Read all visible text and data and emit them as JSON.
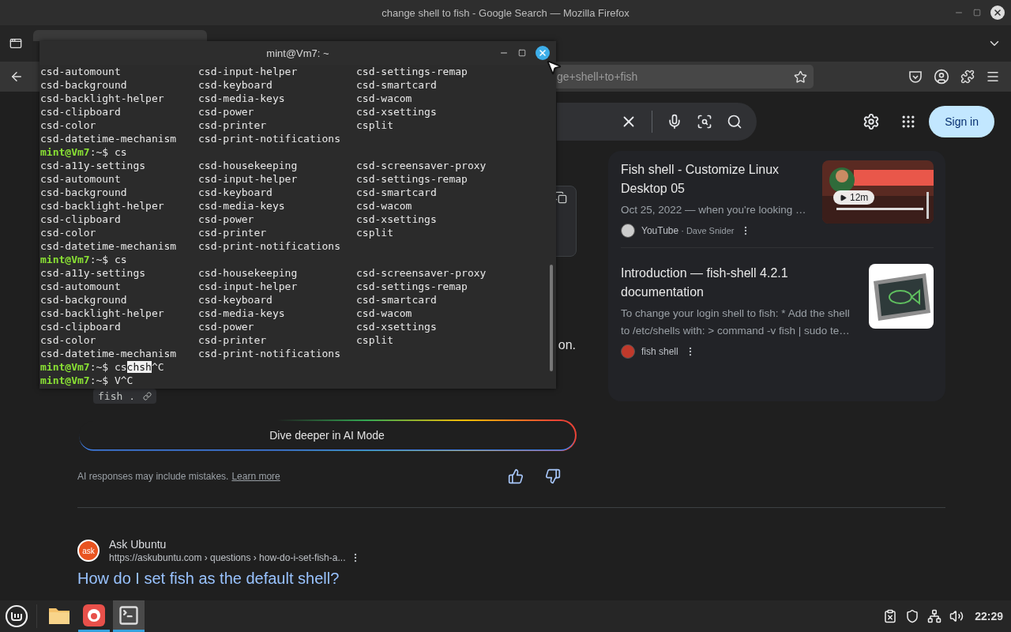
{
  "firefox": {
    "title": "change shell to fish - Google Search — Mozilla Firefox",
    "url_visible": "ge+shell+to+fish"
  },
  "google": {
    "sign_in": "Sign in"
  },
  "ai_overview": {
    "hidden_fragment": "on.",
    "code_chip": "fish .",
    "ai_mode_button": "Dive deeper in AI Mode",
    "disclaimer": "AI responses may include mistakes.",
    "learn_more": "Learn more"
  },
  "side_results": [
    {
      "kind": "video",
      "title": "Fish shell - Customize Linux Desktop 05",
      "snippet": "Oct 25, 2022 — when you're looking …",
      "source": "YouTube",
      "author": "· Dave Snider",
      "duration": "12m"
    },
    {
      "kind": "doc",
      "title": "Introduction — fish-shell 4.2.1 documentation",
      "snippet": "To change your login shell to fish: * Add the shell to /etc/shells with: > command -v fish | sudo te…",
      "source": "fish shell"
    }
  ],
  "result": {
    "site": "Ask Ubuntu",
    "logo_text": "ask",
    "url": "https://askubuntu.com › questions › how-do-i-set-fish-a...",
    "title": "How do I set fish as the default shell?"
  },
  "terminal": {
    "title": "mint@Vm7: ~",
    "lines": [
      {
        "kind": "columns",
        "cells": [
          "csd-automount",
          "csd-input-helper",
          "csd-settings-remap"
        ]
      },
      {
        "kind": "columns",
        "cells": [
          "csd-background",
          "csd-keyboard",
          "csd-smartcard"
        ]
      },
      {
        "kind": "columns",
        "cells": [
          "csd-backlight-helper",
          "csd-media-keys",
          "csd-wacom"
        ]
      },
      {
        "kind": "columns",
        "cells": [
          "csd-clipboard",
          "csd-power",
          "csd-xsettings"
        ]
      },
      {
        "kind": "columns",
        "cells": [
          "csd-color",
          "csd-printer",
          "csplit"
        ]
      },
      {
        "kind": "columns",
        "cells": [
          "csd-datetime-mechanism",
          "csd-print-notifications"
        ]
      },
      {
        "kind": "prompt",
        "user": "mint@Vm7",
        "path": ":~$",
        "input": "cs"
      },
      {
        "kind": "columns",
        "cells": [
          "csd-a11y-settings",
          "csd-housekeeping",
          "csd-screensaver-proxy"
        ]
      },
      {
        "kind": "columns",
        "cells": [
          "csd-automount",
          "csd-input-helper",
          "csd-settings-remap"
        ]
      },
      {
        "kind": "columns",
        "cells": [
          "csd-background",
          "csd-keyboard",
          "csd-smartcard"
        ]
      },
      {
        "kind": "columns",
        "cells": [
          "csd-backlight-helper",
          "csd-media-keys",
          "csd-wacom"
        ]
      },
      {
        "kind": "columns",
        "cells": [
          "csd-clipboard",
          "csd-power",
          "csd-xsettings"
        ]
      },
      {
        "kind": "columns",
        "cells": [
          "csd-color",
          "csd-printer",
          "csplit"
        ]
      },
      {
        "kind": "columns",
        "cells": [
          "csd-datetime-mechanism",
          "csd-print-notifications"
        ]
      },
      {
        "kind": "prompt",
        "user": "mint@Vm7",
        "path": ":~$",
        "input": "cs"
      },
      {
        "kind": "columns",
        "cells": [
          "csd-a11y-settings",
          "csd-housekeeping",
          "csd-screensaver-proxy"
        ]
      },
      {
        "kind": "columns",
        "cells": [
          "csd-automount",
          "csd-input-helper",
          "csd-settings-remap"
        ]
      },
      {
        "kind": "columns",
        "cells": [
          "csd-background",
          "csd-keyboard",
          "csd-smartcard"
        ]
      },
      {
        "kind": "columns",
        "cells": [
          "csd-backlight-helper",
          "csd-media-keys",
          "csd-wacom"
        ]
      },
      {
        "kind": "columns",
        "cells": [
          "csd-clipboard",
          "csd-power",
          "csd-xsettings"
        ]
      },
      {
        "kind": "columns",
        "cells": [
          "csd-color",
          "csd-printer",
          "csplit"
        ]
      },
      {
        "kind": "columns",
        "cells": [
          "csd-datetime-mechanism",
          "csd-print-notifications"
        ]
      },
      {
        "kind": "prompt",
        "user": "mint@Vm7",
        "path": ":~$",
        "input": "cs",
        "selection": "chsh",
        "rest": "^C"
      },
      {
        "kind": "prompt",
        "user": "mint@Vm7",
        "path": ":~$",
        "input": "V^C"
      }
    ]
  },
  "taskbar": {
    "apps": [
      {
        "kind": "files",
        "running": false,
        "active": false
      },
      {
        "kind": "firefox",
        "running": true,
        "active": false
      },
      {
        "kind": "terminal",
        "running": true,
        "active": true
      }
    ],
    "clock": "22:29"
  }
}
